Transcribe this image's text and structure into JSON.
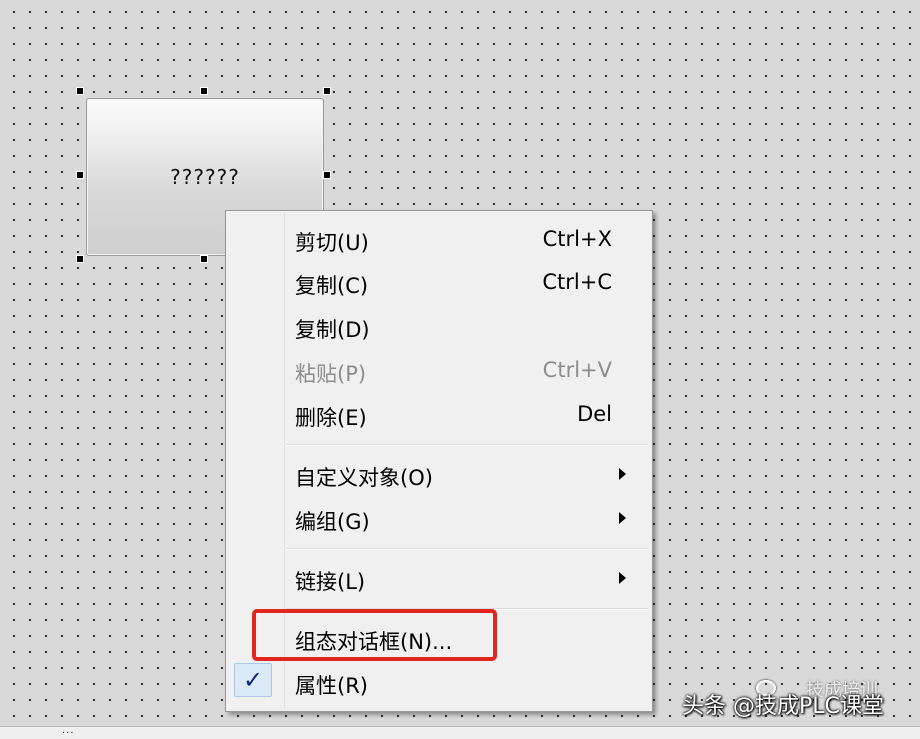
{
  "widget": {
    "label": "??????"
  },
  "context_menu": {
    "items": [
      {
        "label": "剪切(U)",
        "shortcut": "Ctrl+X"
      },
      {
        "label": "复制(C)",
        "shortcut": "Ctrl+C"
      },
      {
        "label": "复制(D)",
        "shortcut": ""
      },
      {
        "label": "粘贴(P)",
        "shortcut": "Ctrl+V",
        "disabled": true
      },
      {
        "label": "删除(E)",
        "shortcut": "Del"
      },
      {
        "label": "自定义对象(O)",
        "submenu": true
      },
      {
        "label": "编组(G)",
        "submenu": true
      },
      {
        "label": "链接(L)",
        "submenu": true
      },
      {
        "label": "组态对话框(N)...",
        "highlighted": true
      },
      {
        "label": "属性(R)",
        "checked": true
      }
    ],
    "check_glyph": "✓",
    "highlight_color": "#e0261f"
  },
  "watermark": {
    "text": "头条 @技成PLC课堂",
    "faint_text": "技成培训"
  },
  "status_bar": {
    "text": "..."
  }
}
